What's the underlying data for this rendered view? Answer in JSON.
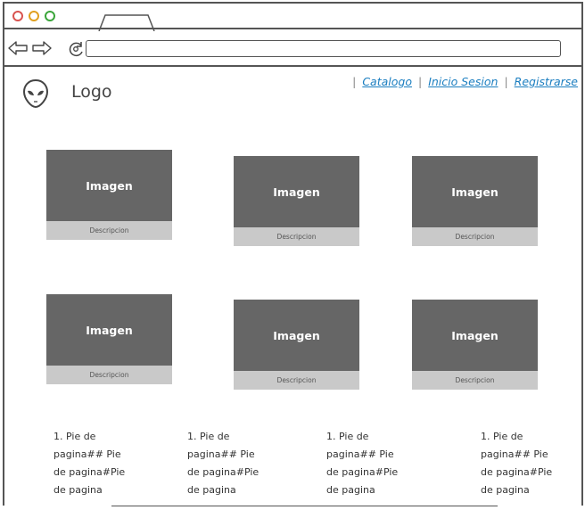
{
  "header": {
    "logo_text": "Logo"
  },
  "nav": {
    "catalogo": "Catalogo",
    "inicio_sesion": "Inicio Sesion",
    "registrarse": "Registrarse",
    "sep": "|"
  },
  "cards": [
    {
      "image_label": "Imagen",
      "description": "Descripcion"
    },
    {
      "image_label": "Imagen",
      "description": "Descripcion"
    },
    {
      "image_label": "Imagen",
      "description": "Descripcion"
    },
    {
      "image_label": "Imagen",
      "description": "Descripcion"
    },
    {
      "image_label": "Imagen",
      "description": "Descripcion"
    },
    {
      "image_label": "Imagen",
      "description": "Descripcion"
    }
  ],
  "footer": [
    [
      "1. Pie de",
      "pagina## Pie",
      "de pagina#Pie",
      "de pagina"
    ],
    [
      "1. Pie de",
      "pagina## Pie",
      "de pagina#Pie",
      "de pagina"
    ],
    [
      "1. Pie de",
      "pagina## Pie",
      "de pagina#Pie",
      "de pagina"
    ],
    [
      "1. Pie de",
      "pagina## Pie",
      "de pagina#Pie",
      "de pagina"
    ]
  ],
  "colors": {
    "link": "#1b7ec0",
    "image_bg": "#666666",
    "desc_bg": "#c9c9c9"
  },
  "icons": [
    "back-arrow-icon",
    "forward-arrow-icon",
    "reload-icon",
    "alien-logo-icon"
  ]
}
